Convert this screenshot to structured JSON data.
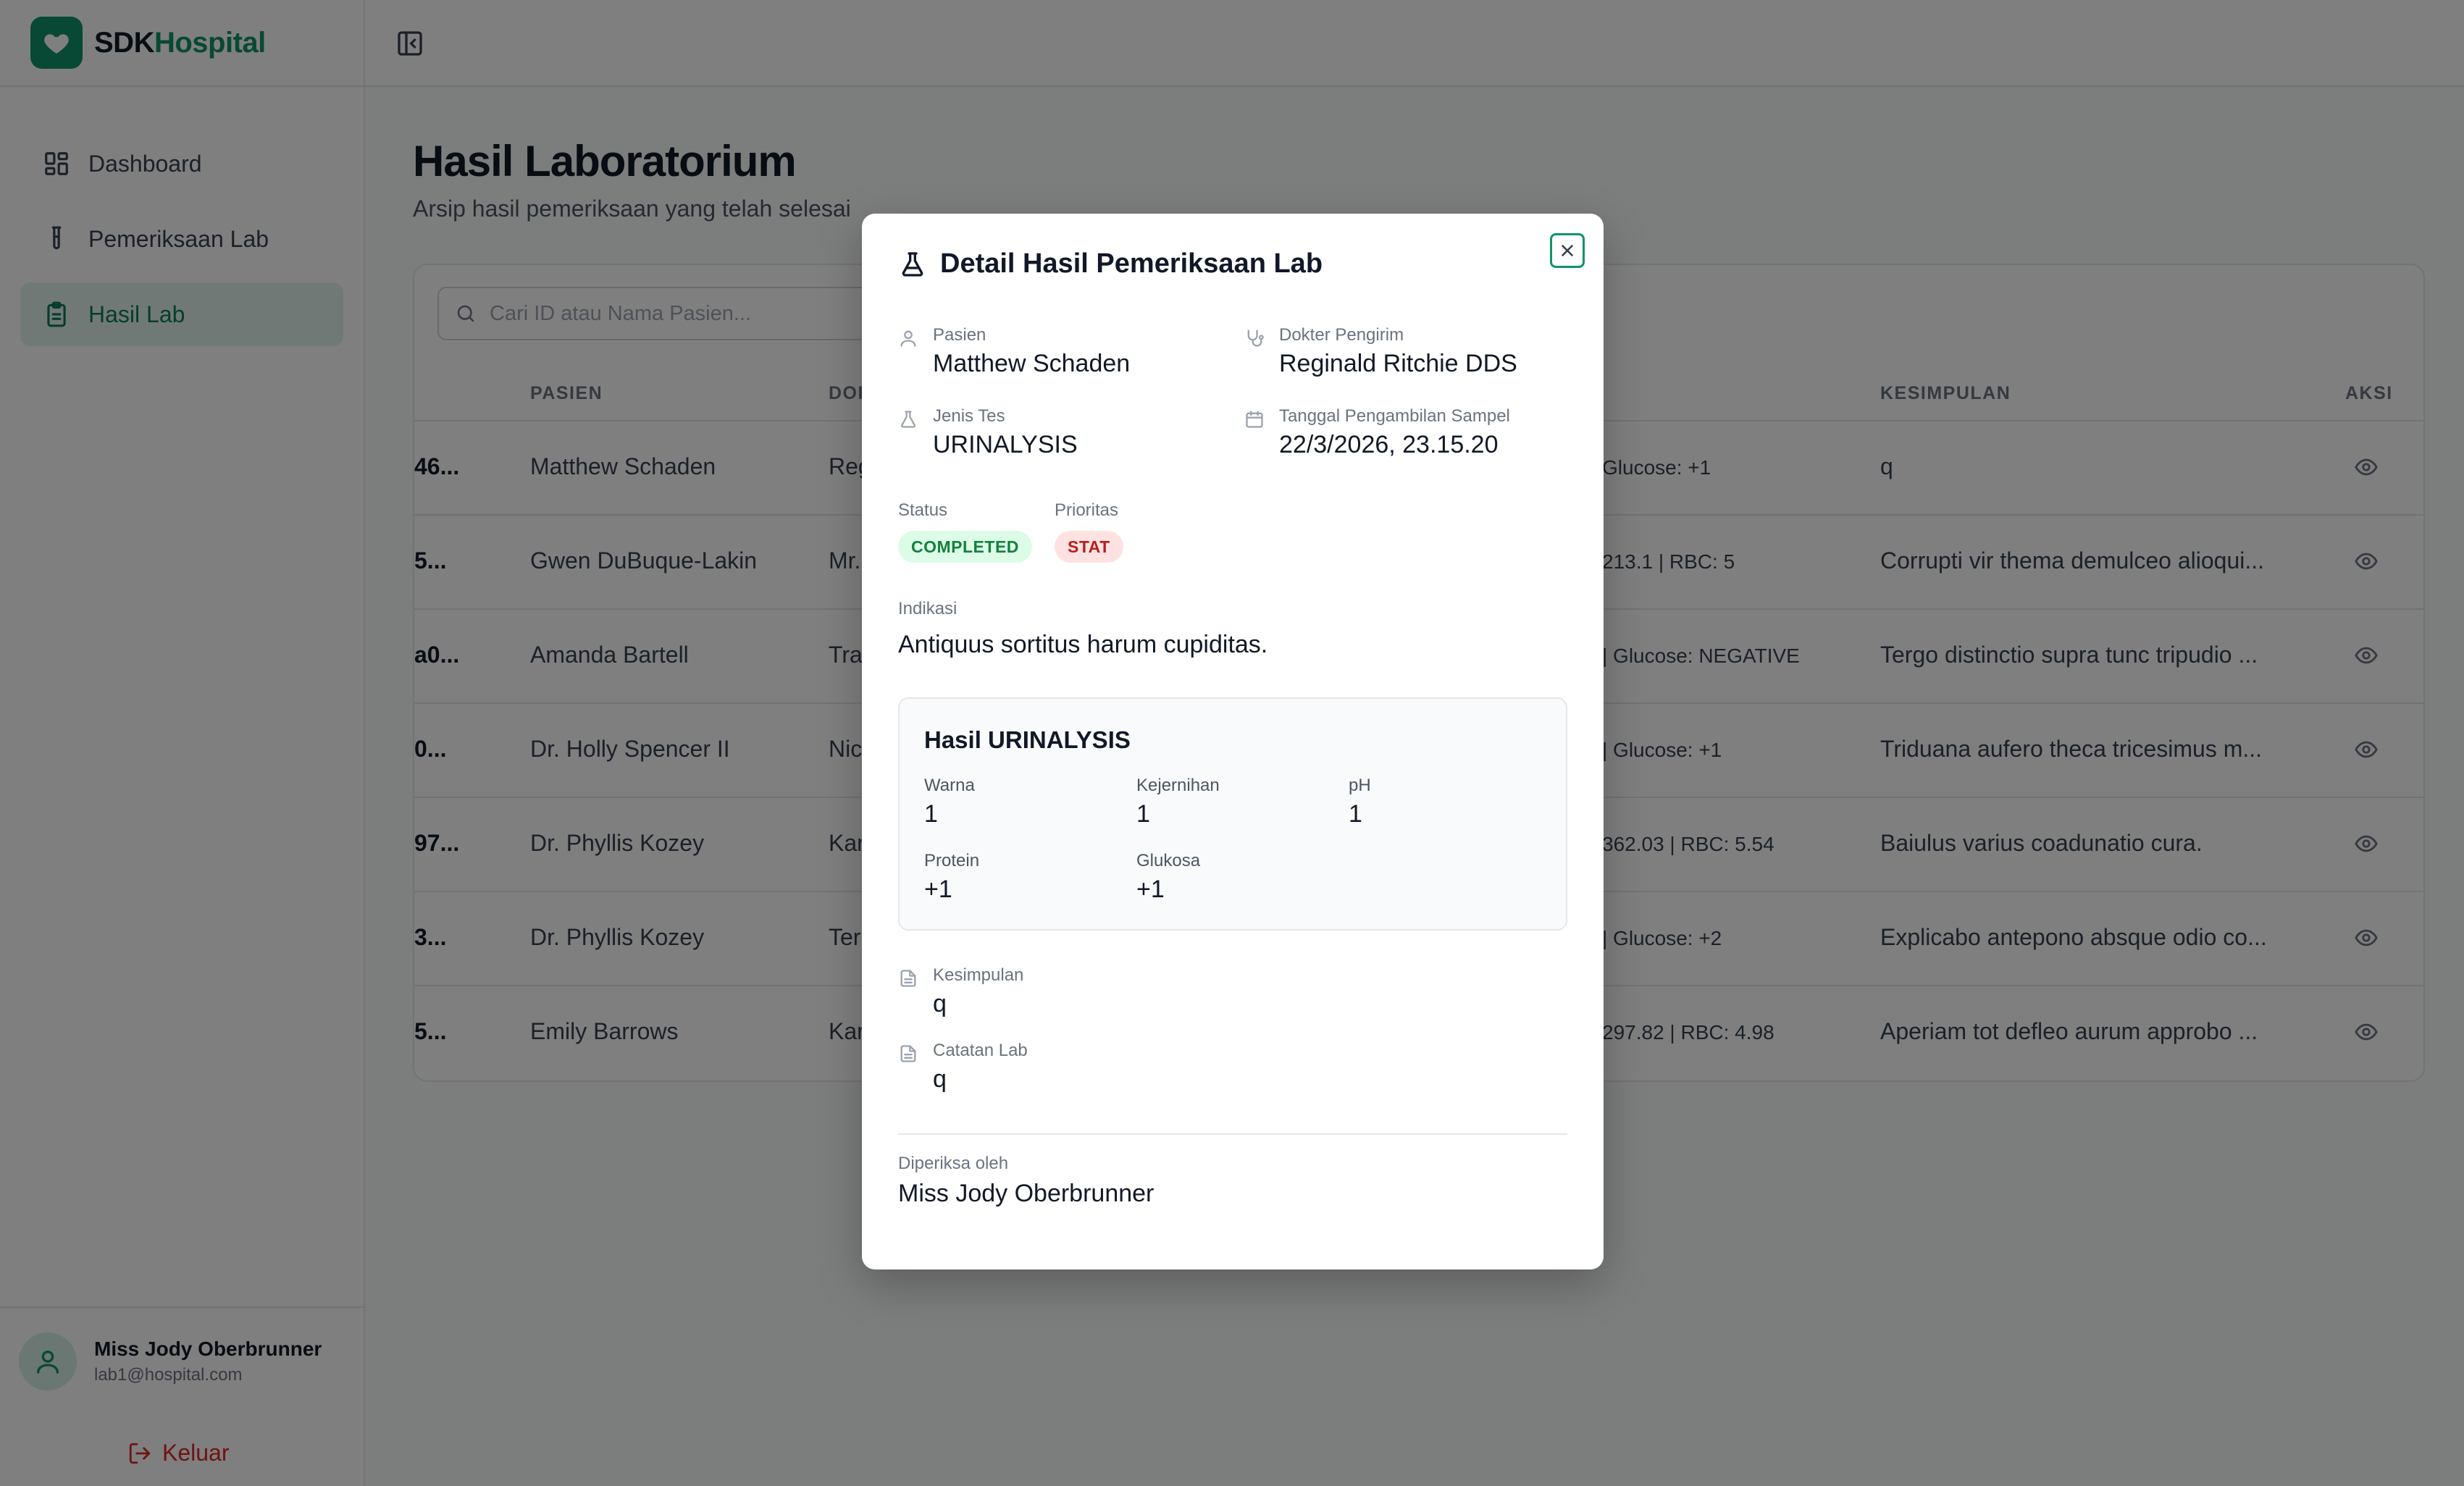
{
  "brand": {
    "part1": "SDK",
    "part2": "Hospital",
    "icon": "heart-icon"
  },
  "sidebar": {
    "items": [
      {
        "label": "Dashboard",
        "icon": "grid-icon",
        "active": false
      },
      {
        "label": "Pemeriksaan Lab",
        "icon": "test-tube-icon",
        "active": false
      },
      {
        "label": "Hasil Lab",
        "icon": "clipboard-icon",
        "active": true
      }
    ],
    "user": {
      "name": "Miss Jody Oberbrunner",
      "email": "lab1@hospital.com"
    },
    "logout_label": "Keluar"
  },
  "page": {
    "title": "Hasil Laboratorium",
    "subtitle": "Arsip hasil pemeriksaan yang telah selesai"
  },
  "search": {
    "placeholder": "Cari ID atau Nama Pasien..."
  },
  "table": {
    "headers": {
      "pasien": "PASIEN",
      "dokter": "DOK",
      "kesimpulan": "KESIMPULAN",
      "aksi": "AKSI"
    },
    "rows": [
      {
        "id": "46...",
        "pasien": "Matthew Schaden",
        "dokter": "Reg",
        "hasil": "Glucose: +1",
        "kesimpulan": "q"
      },
      {
        "id": "5...",
        "pasien": "Gwen DuBuque-Lakin",
        "dokter": "Mr.",
        "hasil": "213.1 | RBC: 5",
        "kesimpulan": "Corrupti vir thema demulceo alioqui..."
      },
      {
        "id": "a0...",
        "pasien": "Amanda Bartell",
        "dokter": "Trav",
        "hasil": "| Glucose: NEGATIVE",
        "kesimpulan": "Tergo distinctio supra tunc tripudio ..."
      },
      {
        "id": "0...",
        "pasien": "Dr. Holly Spencer II",
        "dokter": "Nic",
        "hasil": "| Glucose: +1",
        "kesimpulan": "Triduana aufero theca tricesimus m..."
      },
      {
        "id": "97...",
        "pasien": "Dr. Phyllis Kozey",
        "dokter": "Kar",
        "hasil": "362.03 | RBC: 5.54",
        "kesimpulan": "Baiulus varius coadunatio cura."
      },
      {
        "id": "3...",
        "pasien": "Dr. Phyllis Kozey",
        "dokter": "Terr",
        "hasil": "| Glucose: +2",
        "kesimpulan": "Explicabo antepono absque odio co..."
      },
      {
        "id": "5...",
        "pasien": "Emily Barrows",
        "dokter": "Kar",
        "hasil": "297.82 | RBC: 4.98",
        "kesimpulan": "Aperiam tot defleo aurum approbo ..."
      }
    ]
  },
  "modal": {
    "title": "Detail Hasil Pemeriksaan Lab",
    "pasien_label": "Pasien",
    "pasien": "Matthew Schaden",
    "dokter_label": "Dokter Pengirim",
    "dokter": "Reginald Ritchie DDS",
    "jenis_label": "Jenis Tes",
    "jenis": "URINALYSIS",
    "tanggal_label": "Tanggal Pengambilan Sampel",
    "tanggal": "22/3/2026, 23.15.20",
    "status_label": "Status",
    "status": "COMPLETED",
    "prioritas_label": "Prioritas",
    "prioritas": "STAT",
    "indikasi_label": "Indikasi",
    "indikasi": "Antiquus sortitus harum cupiditas.",
    "hasil_title": "Hasil URINALYSIS",
    "hasil": {
      "warna_label": "Warna",
      "warna": "1",
      "kejernihan_label": "Kejernihan",
      "kejernihan": "1",
      "ph_label": "pH",
      "ph": "1",
      "protein_label": "Protein",
      "protein": "+1",
      "glukosa_label": "Glukosa",
      "glukosa": "+1"
    },
    "kesimpulan_label": "Kesimpulan",
    "kesimpulan": "q",
    "catatan_label": "Catatan Lab",
    "catatan": "q",
    "pemeriksa_label": "Diperiksa oleh",
    "pemeriksa": "Miss Jody Oberbrunner"
  },
  "colors": {
    "brand": "#10936b",
    "active_bg": "#e3f3ec",
    "danger": "#dc2626"
  }
}
